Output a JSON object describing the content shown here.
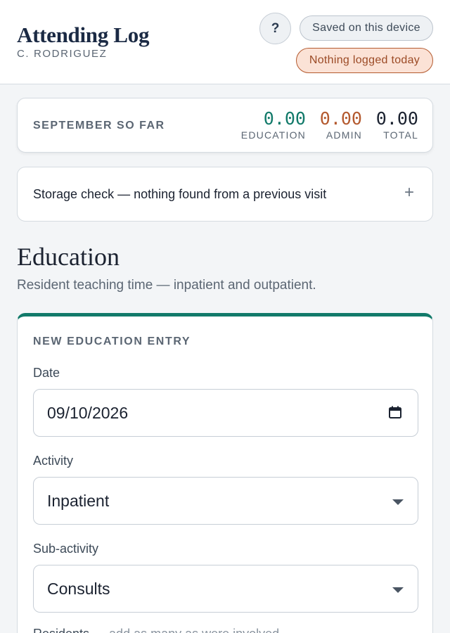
{
  "app": {
    "title": "Attending Log",
    "user": "C. RODRIGUEZ",
    "help_label": "?",
    "saved_status": "Saved on this device",
    "today_status": "Nothing logged today"
  },
  "summary": {
    "label": "SEPTEMBER SO FAR",
    "stats": [
      {
        "value": "0.00",
        "label": "EDUCATION",
        "color": "#127a6a"
      },
      {
        "value": "0.00",
        "label": "ADMIN",
        "color": "#b45a2f"
      },
      {
        "value": "0.00",
        "label": "TOTAL",
        "color": "#1b2230"
      }
    ]
  },
  "storage": {
    "text": "Storage check — nothing found from a previous visit",
    "expand_icon": "+"
  },
  "section": {
    "title": "Education",
    "subtitle": "Resident teaching time — inpatient and outpatient."
  },
  "form": {
    "heading": "NEW EDUCATION ENTRY",
    "accent_color": "#127a6a",
    "date": {
      "label": "Date",
      "value": "09/10/2026",
      "icon": "calendar-icon"
    },
    "activity": {
      "label": "Activity",
      "value": "Inpatient",
      "icon": "chevron-down-icon"
    },
    "subactivity": {
      "label": "Sub-activity",
      "value": "Consults",
      "icon": "chevron-down-icon"
    },
    "residents": {
      "label": "Residents",
      "hint": " — add as many as were involved"
    }
  }
}
